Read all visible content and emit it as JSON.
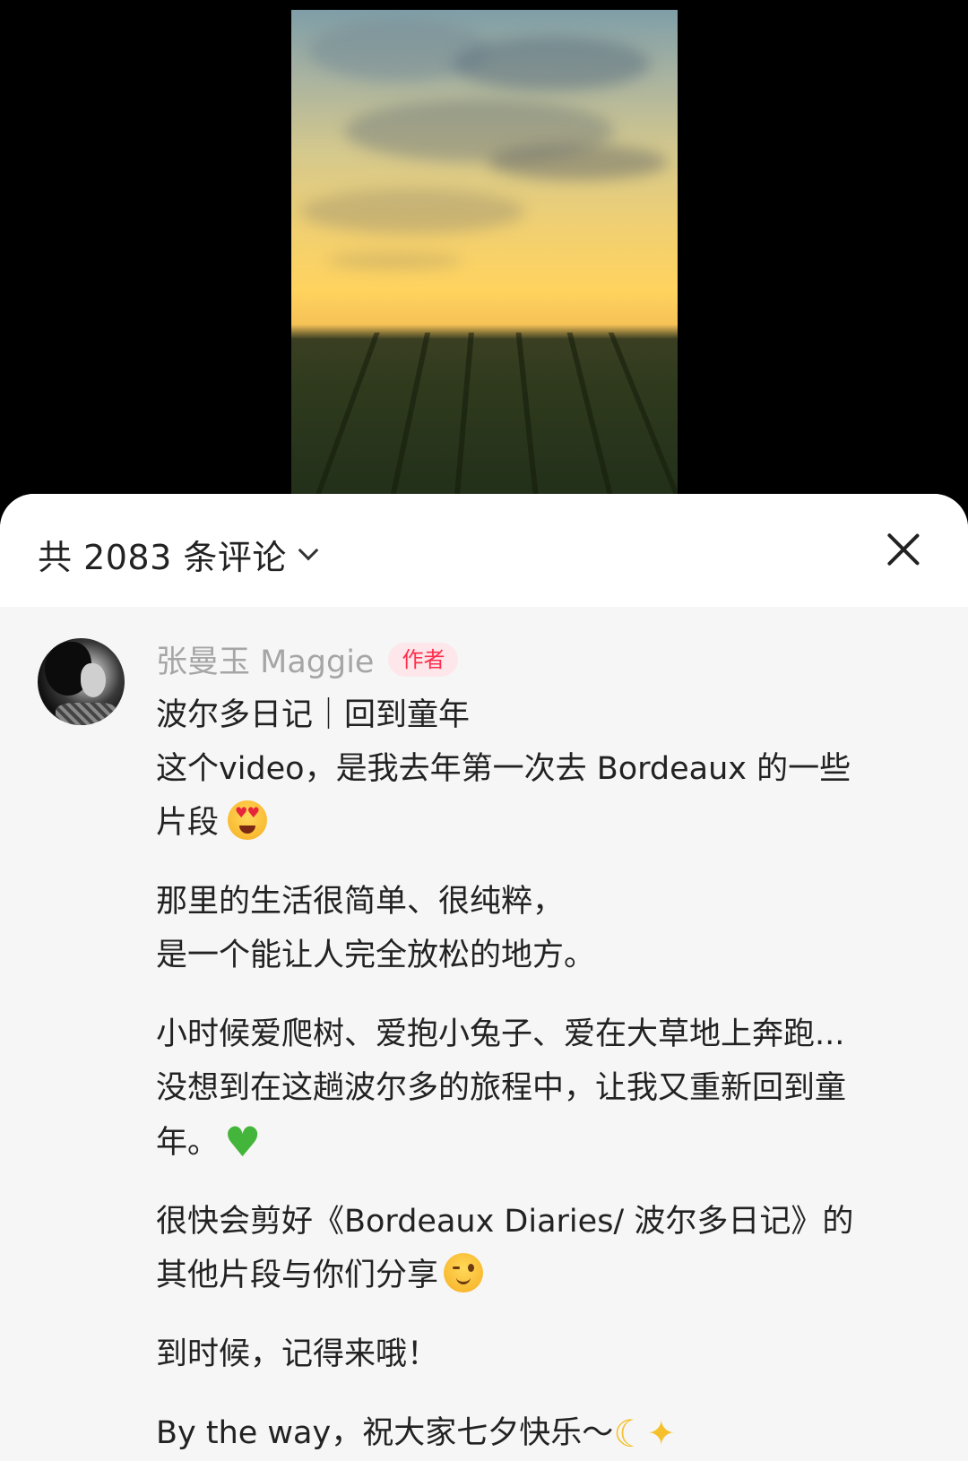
{
  "header": {
    "comment_count_label": "共 2083 条评论",
    "chevron_icon": "chevron-down-icon",
    "close_icon": "close-icon"
  },
  "comment": {
    "author_name": "张曼玉 Maggie",
    "author_badge": "作者",
    "title": "波尔多日记｜回到童年",
    "paragraphs": [
      {
        "lines": [
          "这个video，是我去年第一次去 Bordeaux 的一些",
          "片段"
        ],
        "emoji": "heart-eyes-emoji"
      },
      {
        "lines": [
          "那里的生活很简单、很纯粹，",
          "是一个能让人完全放松的地方。"
        ]
      },
      {
        "lines": [
          "小时候爱爬树、爱抱小兔子、爱在大草地上奔跑...",
          "没想到在这趟波尔多的旅程中，让我又重新回到童",
          "年。"
        ],
        "emoji": "green-heart-emoji"
      },
      {
        "lines": [
          "很快会剪好《Bordeaux Diaries/ 波尔多日记》的",
          "其他片段与你们分享"
        ],
        "emoji": "wink-emoji"
      },
      {
        "lines": [
          "到时候，记得来哦！"
        ]
      },
      {
        "lines": [
          "By the way，祝大家七夕快乐～"
        ],
        "emoji": "moon-sparkles-emoji"
      }
    ]
  },
  "colors": {
    "badge_text": "#ff2e4d",
    "badge_bg": "#fde7ea",
    "author_name": "#a6a6a6",
    "body_text": "#222222",
    "panel_body_bg": "#f6f6f6"
  }
}
